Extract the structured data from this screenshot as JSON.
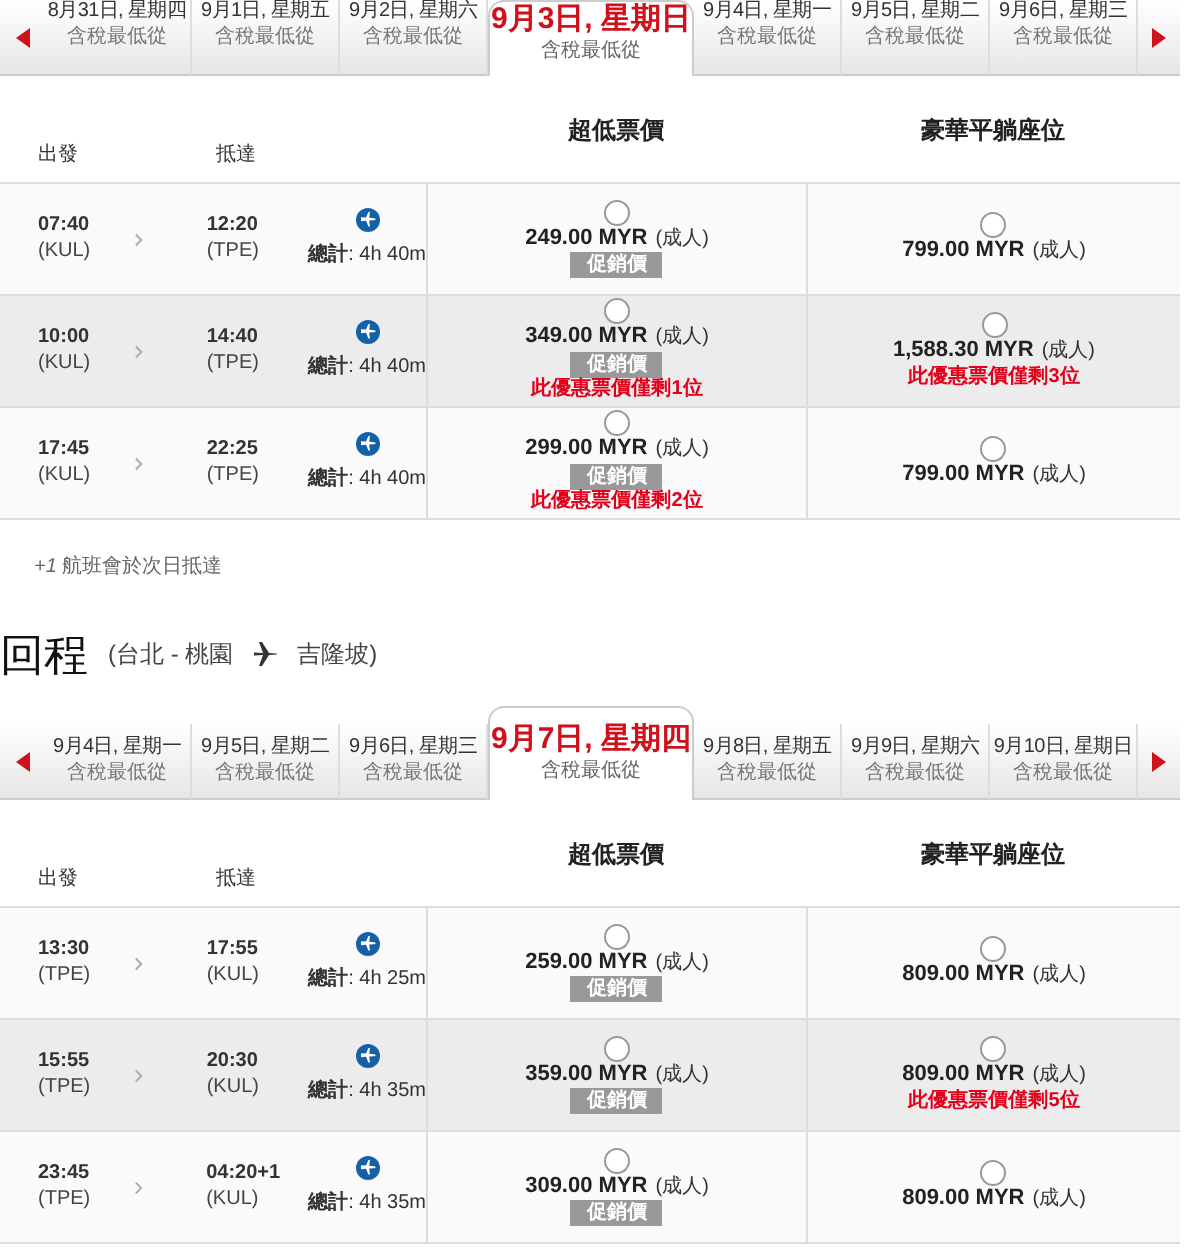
{
  "outbound": {
    "date_tabs": [
      {
        "date": "8月31日, 星期四",
        "note": "含稅最低從",
        "selected": false
      },
      {
        "date": "9月1日, 星期五",
        "note": "含稅最低從",
        "selected": false
      },
      {
        "date": "9月2日, 星期六",
        "note": "含稅最低從",
        "selected": false
      },
      {
        "date": "9月3日, 星期日",
        "note": "含稅最低從",
        "selected": true
      },
      {
        "date": "9月4日, 星期一",
        "note": "含稅最低從",
        "selected": false
      },
      {
        "date": "9月5日, 星期二",
        "note": "含稅最低從",
        "selected": false
      },
      {
        "date": "9月6日, 星期三",
        "note": "含稅最低從",
        "selected": false
      }
    ],
    "columns": {
      "depart": "出發",
      "arrive": "抵達",
      "fare_1": "超低票價",
      "fare_2": "豪華平躺座位"
    },
    "flights": [
      {
        "highlighted": false,
        "depart_time": "07:40",
        "depart_code": "(KUL)",
        "arrive_time": "12:20",
        "arrive_code": "(TPE)",
        "duration": "**總計**: 4h 40m",
        "fares": [
          {
            "price": "249.00 MYR",
            "unit": "(成人)",
            "selected": false,
            "badge": "促銷價"
          },
          {
            "price": "799.00 MYR",
            "unit": "(成人)",
            "selected": false
          }
        ]
      },
      {
        "highlighted": true,
        "depart_time": "10:00",
        "depart_code": "(KUL)",
        "arrive_time": "14:40",
        "arrive_code": "(TPE)",
        "duration": "**總計**: 4h 40m",
        "fares": [
          {
            "price": "349.00 MYR",
            "unit": "(成人)",
            "selected": false,
            "badge": "促銷價",
            "warning": "此優惠票價僅剩1位"
          },
          {
            "price": "1,588.30 MYR",
            "unit": "(成人)",
            "selected": false,
            "warning": "此優惠票價僅剩3位"
          }
        ]
      },
      {
        "highlighted": false,
        "depart_time": "17:45",
        "depart_code": "(KUL)",
        "arrive_time": "22:25",
        "arrive_code": "(TPE)",
        "duration": "**總計**: 4h 40m",
        "fares": [
          {
            "price": "299.00 MYR",
            "unit": "(成人)",
            "selected": false,
            "badge": "促銷價",
            "warning": "此優惠票價僅剩2位"
          },
          {
            "price": "799.00 MYR",
            "unit": "(成人)",
            "selected": false
          }
        ]
      }
    ],
    "footnote": "*+1* 航班會於次日抵達"
  },
  "return": {
    "title": "回程",
    "route_from": "(台北 - 桃園",
    "route_to": "吉隆坡)",
    "date_tabs": [
      {
        "date": "9月4日, 星期一",
        "note": "含稅最低從",
        "selected": false
      },
      {
        "date": "9月5日, 星期二",
        "note": "含稅最低從",
        "selected": false
      },
      {
        "date": "9月6日, 星期三",
        "note": "含稅最低從",
        "selected": false
      },
      {
        "date": "9月7日, 星期四",
        "note": "含稅最低從",
        "selected": true
      },
      {
        "date": "9月8日, 星期五",
        "note": "含稅最低從",
        "selected": false
      },
      {
        "date": "9月9日, 星期六",
        "note": "含稅最低從",
        "selected": false
      },
      {
        "date": "9月10日, 星期日",
        "note": "含稅最低從",
        "selected": false
      }
    ],
    "columns": {
      "depart": "出發",
      "arrive": "抵達",
      "fare_1": "超低票價",
      "fare_2": "豪華平躺座位"
    },
    "flights": [
      {
        "highlighted": false,
        "depart_time": "13:30",
        "depart_code": "(TPE)",
        "arrive_time": "17:55",
        "arrive_code": "(KUL)",
        "duration": "**總計**: 4h 25m",
        "fares": [
          {
            "price": "259.00 MYR",
            "unit": "(成人)",
            "selected": false,
            "badge": "促銷價"
          },
          {
            "price": "809.00 MYR",
            "unit": "(成人)",
            "selected": false
          }
        ]
      },
      {
        "highlighted": true,
        "depart_time": "15:55",
        "depart_code": "(TPE)",
        "arrive_time": "20:30",
        "arrive_code": "(KUL)",
        "duration": "**總計**: 4h 35m",
        "fares": [
          {
            "price": "359.00 MYR",
            "unit": "(成人)",
            "selected": false,
            "badge": "促銷價"
          },
          {
            "price": "809.00 MYR",
            "unit": "(成人)",
            "selected": false,
            "warning": "此優惠票價僅剩5位"
          }
        ]
      },
      {
        "highlighted": false,
        "depart_time": "23:45",
        "depart_code": "(TPE)",
        "arrive_time": "04:20",
        "next_day": "+1",
        "arrive_code": "(KUL)",
        "duration": "**總計**: 4h 35m",
        "fares": [
          {
            "price": "309.00 MYR",
            "unit": "(成人)",
            "selected": false,
            "badge": "促銷價"
          },
          {
            "price": "809.00 MYR",
            "unit": "(成人)",
            "selected": false
          }
        ]
      }
    ]
  }
}
